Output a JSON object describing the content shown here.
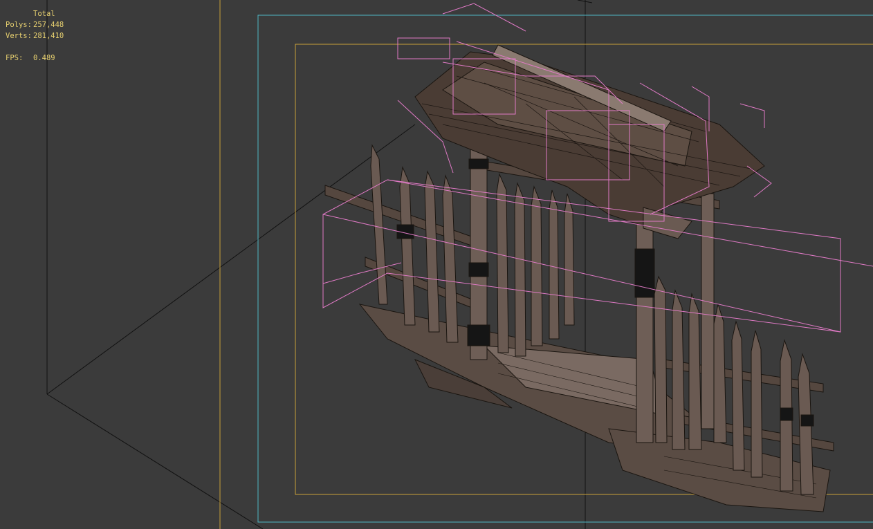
{
  "viewport": {
    "stats": {
      "title": "Total",
      "polys_label": "Polys:",
      "polys_value": "257,448",
      "verts_label": "Verts:",
      "verts_value": "281,410",
      "fps_label": "FPS:",
      "fps_value": "0.489"
    },
    "colors": {
      "background": "#3b3b3b",
      "stats_text": "#e8d170",
      "safe_frame_outer": "#4fb7c6",
      "safe_frame_inner": "#c9a13a",
      "bounding_box": "#e07ac6",
      "grid_line": "#111111",
      "wireframe": "#1a1510"
    }
  }
}
